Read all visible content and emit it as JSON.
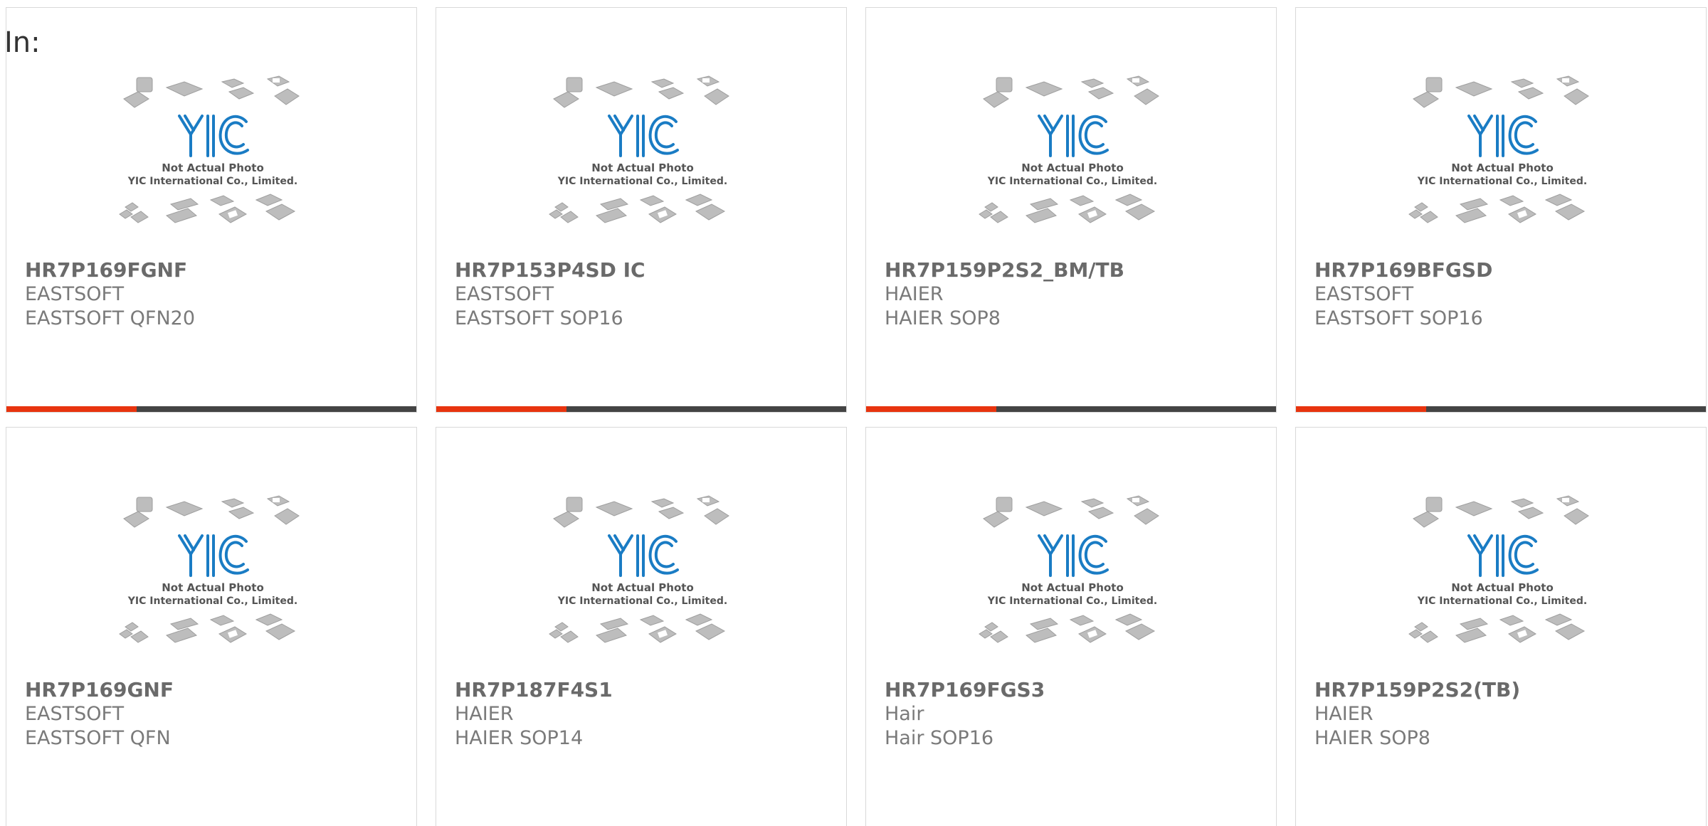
{
  "header": {
    "label": "In:"
  },
  "thumbnail": {
    "line1": "Not Actual Photo",
    "line2": "YIC International Co., Limited.",
    "logo": "YIC"
  },
  "colors": {
    "accent": "#e8340f",
    "bar": "#444444",
    "logo": "#1a7cc4"
  },
  "products": [
    {
      "part": "HR7P169FGNF",
      "manufacturer": "EASTSOFT",
      "package": "EASTSOFT QFN20"
    },
    {
      "part": "HR7P153P4SD IC",
      "manufacturer": "EASTSOFT",
      "package": "EASTSOFT SOP16"
    },
    {
      "part": "HR7P159P2S2_BM/TB",
      "manufacturer": "HAIER",
      "package": "HAIER SOP8"
    },
    {
      "part": "HR7P169BFGSD",
      "manufacturer": "EASTSOFT",
      "package": "EASTSOFT SOP16"
    },
    {
      "part": "HR7P169GNF",
      "manufacturer": "EASTSOFT",
      "package": "EASTSOFT QFN"
    },
    {
      "part": "HR7P187F4S1",
      "manufacturer": "HAIER",
      "package": "HAIER SOP14"
    },
    {
      "part": "HR7P169FGS3",
      "manufacturer": "Hair",
      "package": "Hair SOP16"
    },
    {
      "part": "HR7P159P2S2(TB)",
      "manufacturer": "HAIER",
      "package": "HAIER SOP8"
    }
  ]
}
